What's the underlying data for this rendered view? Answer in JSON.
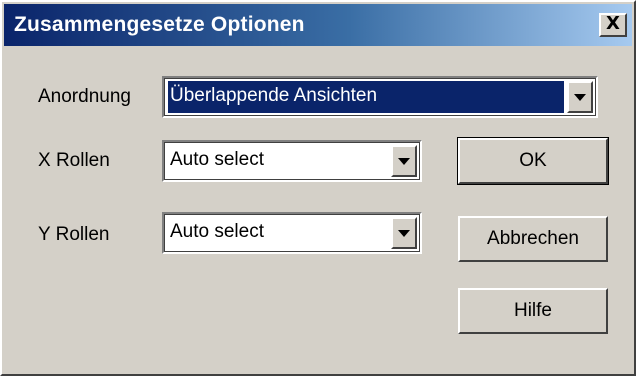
{
  "window": {
    "title": "Zusammengesetze Optionen",
    "close_label": "X"
  },
  "form": {
    "anordnung": {
      "label": "Anordnung",
      "value": "Überlappende Ansichten"
    },
    "x_rollen": {
      "label": "X Rollen",
      "value": "Auto select"
    },
    "y_rollen": {
      "label": "Y Rollen",
      "value": "Auto select"
    }
  },
  "buttons": {
    "ok": "OK",
    "cancel": "Abbrechen",
    "help": "Hilfe"
  },
  "colors": {
    "title_gradient_start": "#0a246a",
    "title_gradient_end": "#a6caf0",
    "dialog_background": "#d4d0c8",
    "selection": "#0a246a"
  },
  "icons": {
    "close": "close-icon",
    "dropdown": "chevron-down-icon"
  }
}
